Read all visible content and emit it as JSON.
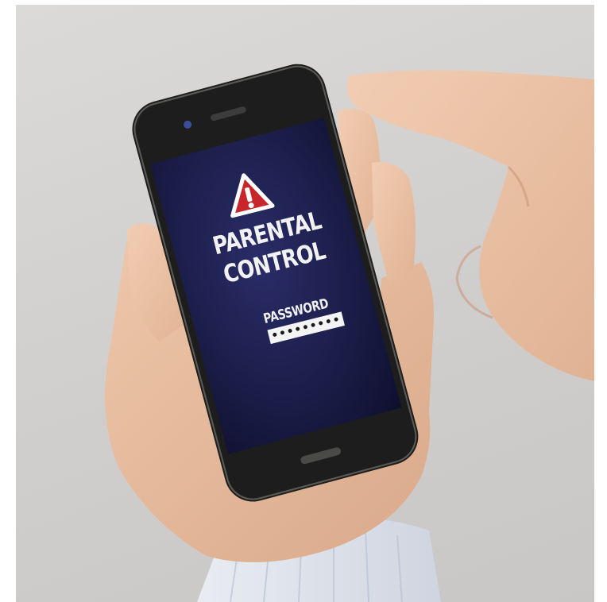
{
  "screen": {
    "title_line1": "PARENTAL",
    "title_line2": "CONTROL",
    "password_label": "PASSWORD",
    "password_value": "•••••••••"
  },
  "colors": {
    "warning_red": "#c9262b",
    "screen_dark": "#14163a",
    "phone_body": "#1d1d1d"
  },
  "icons": {
    "warning": "warning-triangle-icon"
  }
}
